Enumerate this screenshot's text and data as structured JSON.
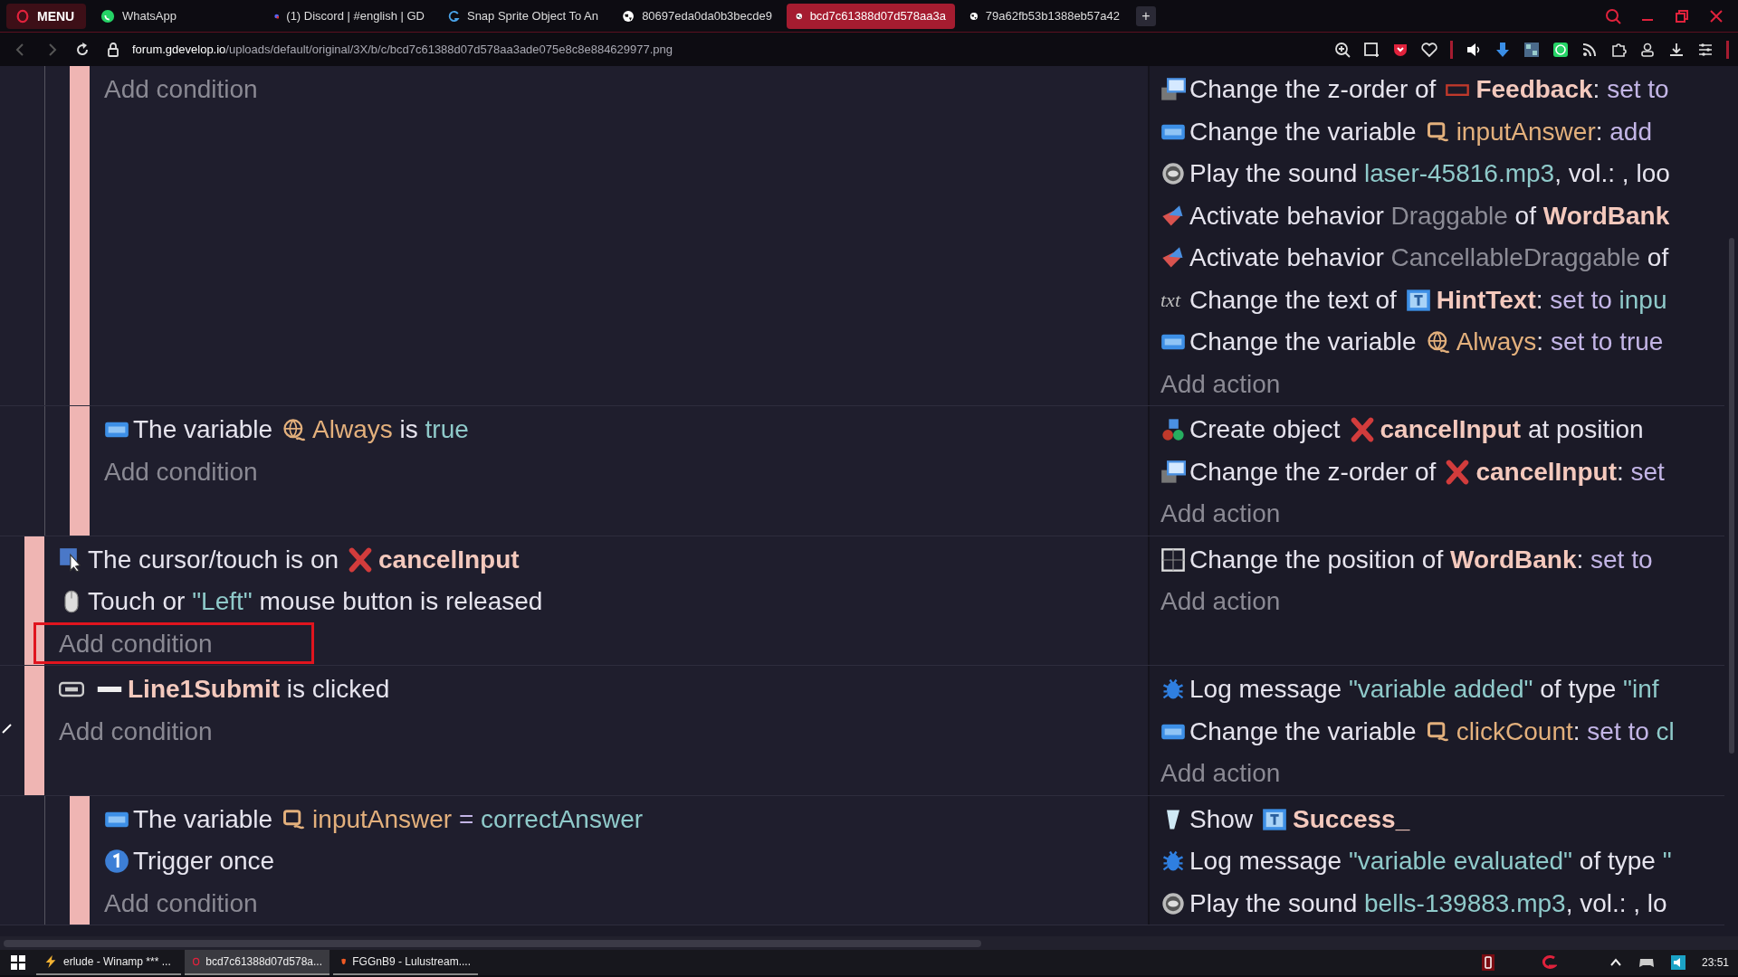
{
  "browser": {
    "menu_label": "MENU",
    "tabs": [
      {
        "title": "WhatsApp",
        "kind": "whatsapp",
        "selected": false
      },
      {
        "title": "(1) Discord | #english | GD",
        "kind": "discord",
        "selected": false
      },
      {
        "title": "Snap Sprite Object To An",
        "kind": "swirl",
        "selected": false
      },
      {
        "title": "80697eda0da0b3becde9",
        "kind": "globe",
        "selected": false
      },
      {
        "title": "bcd7c61388d07d578aa3a",
        "kind": "globe",
        "selected": true
      },
      {
        "title": "79a62fb53b1388eb57a42",
        "kind": "globe",
        "selected": false
      }
    ],
    "new_tab": "+",
    "url_host": "forum.gdevelop.io",
    "url_path": "/uploads/default/original/3X/b/c/bcd7c61388d07d578aa3ade075e8c8e884629977.png"
  },
  "events": [
    {
      "children": [
        {
          "conditions": [
            {
              "kind": "add",
              "text": "Add condition",
              "highlighted": false
            }
          ],
          "actions": [
            {
              "kind": "z-order",
              "parts": [
                {
                  "text": "Change the z-order of"
                },
                {
                  "kind": "panel-object"
                },
                {
                  "text": "Feedback",
                  "kind": "object"
                },
                {
                  "text": ": "
                },
                {
                  "text": "set to",
                  "kind": "operator"
                }
              ]
            },
            {
              "kind": "change-variable",
              "parts": [
                {
                  "text": "Change the variable"
                },
                {
                  "kind": "scene-variable"
                },
                {
                  "text": "inputAnswer",
                  "kind": "variable"
                },
                {
                  "text": ": "
                },
                {
                  "text": "add",
                  "kind": "operator"
                }
              ]
            },
            {
              "kind": "play-sound",
              "parts": [
                {
                  "text": "Play the sound "
                },
                {
                  "text": "laser-45816.mp3",
                  "kind": "value"
                },
                {
                  "text": ", vol.: , loo"
                }
              ]
            },
            {
              "kind": "activate-behavior",
              "parts": [
                {
                  "text": "Activate behavior "
                },
                {
                  "text": "Draggable",
                  "kind": "behavior"
                },
                {
                  "text": " of "
                },
                {
                  "text": "WordBank",
                  "kind": "object"
                }
              ]
            },
            {
              "kind": "activate-behavior",
              "parts": [
                {
                  "text": "Activate behavior "
                },
                {
                  "text": "CancellableDraggable",
                  "kind": "behavior"
                },
                {
                  "text": " of"
                }
              ]
            },
            {
              "kind": "change-text",
              "glyph": "txt",
              "parts": [
                {
                  "text": "Change the text of"
                },
                {
                  "kind": "text-object"
                },
                {
                  "text": "HintText",
                  "kind": "object"
                },
                {
                  "text": ": "
                },
                {
                  "text": "set to",
                  "kind": "operator"
                },
                {
                  "text": " inpu",
                  "kind": "value"
                }
              ]
            },
            {
              "kind": "change-variable",
              "parts": [
                {
                  "text": "Change the variable"
                },
                {
                  "kind": "global-variable"
                },
                {
                  "text": "Always",
                  "kind": "variable"
                },
                {
                  "text": ": "
                },
                {
                  "text": "set to true",
                  "kind": "operator"
                }
              ]
            },
            {
              "kind": "add",
              "text": "Add action",
              "highlighted": false
            }
          ]
        },
        {
          "conditions": [
            {
              "kind": "variable-condition",
              "parts": [
                {
                  "text": "The variable"
                },
                {
                  "kind": "global-variable"
                },
                {
                  "text": "Always",
                  "kind": "variable"
                },
                {
                  "text": " is "
                },
                {
                  "text": "true",
                  "kind": "value"
                }
              ]
            },
            {
              "kind": "add",
              "text": "Add condition",
              "highlighted": false
            }
          ],
          "actions": [
            {
              "kind": "create-object",
              "parts": [
                {
                  "text": "Create object"
                },
                {
                  "kind": "sprite-object"
                },
                {
                  "text": "cancelInput",
                  "kind": "object"
                },
                {
                  "text": " at position"
                }
              ]
            },
            {
              "kind": "z-order",
              "parts": [
                {
                  "text": "Change the z-order of"
                },
                {
                  "kind": "sprite-object"
                },
                {
                  "text": "cancelInput",
                  "kind": "object"
                },
                {
                  "text": ": "
                },
                {
                  "text": "set",
                  "kind": "operator"
                }
              ]
            },
            {
              "kind": "add",
              "text": "Add action",
              "highlighted": false
            }
          ]
        }
      ]
    },
    {
      "conditions": [
        {
          "kind": "cursor-on",
          "parts": [
            {
              "text": "The cursor/touch is on"
            },
            {
              "kind": "sprite-object"
            },
            {
              "text": "cancelInput",
              "kind": "object"
            }
          ]
        },
        {
          "kind": "mouse-released",
          "parts": [
            {
              "text": "Touch or "
            },
            {
              "text": "\"Left\"",
              "kind": "value"
            },
            {
              "text": " mouse button is released"
            }
          ]
        },
        {
          "kind": "add",
          "text": "Add condition",
          "highlighted": true
        }
      ],
      "actions": [
        {
          "kind": "change-position",
          "parts": [
            {
              "text": "Change the position of "
            },
            {
              "text": "WordBank",
              "kind": "object"
            },
            {
              "text": ": "
            },
            {
              "text": "set to",
              "kind": "operator"
            }
          ]
        },
        {
          "kind": "add",
          "text": "Add action",
          "highlighted": false
        }
      ]
    },
    {
      "conditions": [
        {
          "kind": "button-clicked",
          "parts": [
            {
              "kind": "shape-object"
            },
            {
              "text": "Line1Submit",
              "kind": "object"
            },
            {
              "text": " is clicked"
            }
          ]
        },
        {
          "kind": "add",
          "text": "Add condition",
          "highlighted": false
        }
      ],
      "actions": [
        {
          "kind": "log-message",
          "parts": [
            {
              "text": "Log message "
            },
            {
              "text": "\"variable added\"",
              "kind": "value"
            },
            {
              "text": " of type "
            },
            {
              "text": "\"inf",
              "kind": "value"
            }
          ]
        },
        {
          "kind": "change-variable",
          "parts": [
            {
              "text": "Change the variable"
            },
            {
              "kind": "scene-variable"
            },
            {
              "text": "clickCount",
              "kind": "variable"
            },
            {
              "text": ": "
            },
            {
              "text": "set to",
              "kind": "operator"
            },
            {
              "text": " cl",
              "kind": "value"
            }
          ]
        },
        {
          "kind": "add",
          "text": "Add action",
          "highlighted": false
        }
      ],
      "children": [
        {
          "conditions": [
            {
              "kind": "variable-condition",
              "parts": [
                {
                  "text": "The variable"
                },
                {
                  "kind": "scene-variable"
                },
                {
                  "text": "inputAnswer",
                  "kind": "variable"
                },
                {
                  "text": " = ",
                  "kind": "operator"
                },
                {
                  "text": "correctAnswer",
                  "kind": "value"
                }
              ]
            },
            {
              "kind": "trigger-once",
              "parts": [
                {
                  "text": "Trigger once"
                }
              ]
            },
            {
              "kind": "add",
              "text": "Add condition",
              "highlighted": false
            }
          ],
          "actions": [
            {
              "kind": "show",
              "parts": [
                {
                  "text": "Show"
                },
                {
                  "kind": "text-object"
                },
                {
                  "text": "Success_",
                  "kind": "object"
                }
              ]
            },
            {
              "kind": "log-message",
              "parts": [
                {
                  "text": "Log message "
                },
                {
                  "text": "\"variable evaluated\"",
                  "kind": "value"
                },
                {
                  "text": " of type "
                },
                {
                  "text": "\"",
                  "kind": "value"
                }
              ]
            },
            {
              "kind": "play-sound",
              "parts": [
                {
                  "text": "Play the sound "
                },
                {
                  "text": "bells-139883.mp3",
                  "kind": "value"
                },
                {
                  "text": ", vol.: , lo"
                }
              ]
            }
          ]
        }
      ]
    }
  ],
  "taskbar": {
    "items": [
      {
        "title": "erlude - Winamp *** ...",
        "kind": "winamp",
        "selected": false
      },
      {
        "title": "bcd7c61388d07d578a...",
        "kind": "opera",
        "selected": true
      },
      {
        "title": "FGGnB9 - Lulustream....",
        "kind": "brave",
        "selected": false
      }
    ],
    "clock": "23:51"
  }
}
